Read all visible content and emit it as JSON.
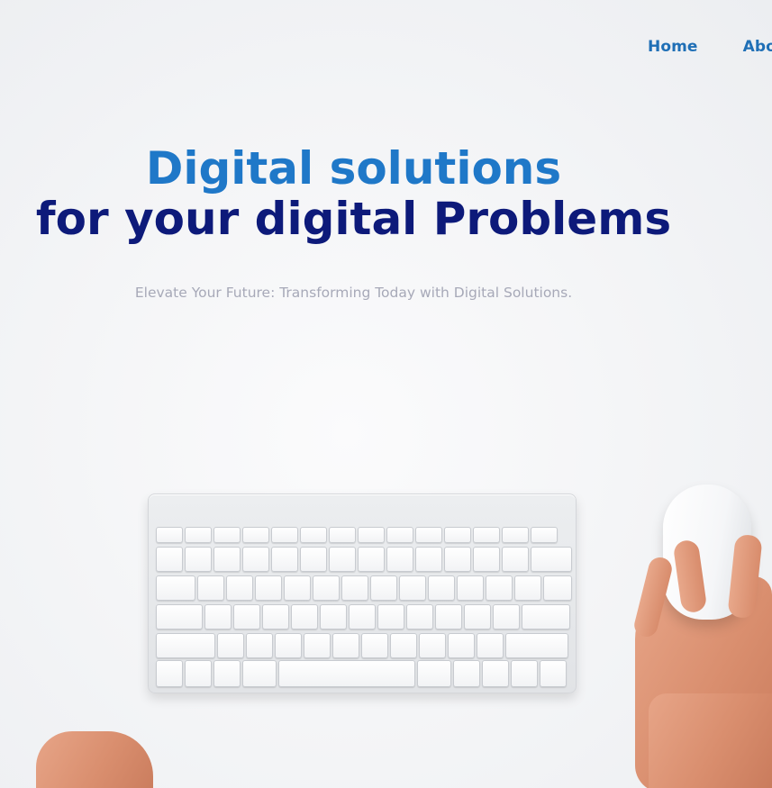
{
  "nav": {
    "items": [
      {
        "label": "Home"
      },
      {
        "label": "About"
      }
    ]
  },
  "hero": {
    "title_line1": "Digital solutions",
    "title_line2": "for your digital Problems",
    "tagline": "Elevate Your Future: Transforming Today with Digital Solutions."
  },
  "colors": {
    "nav_link": "#1f6fb6",
    "title_accent": "#1f78c8",
    "title_dark": "#0d1a7a",
    "tagline": "#a7a9b8"
  }
}
